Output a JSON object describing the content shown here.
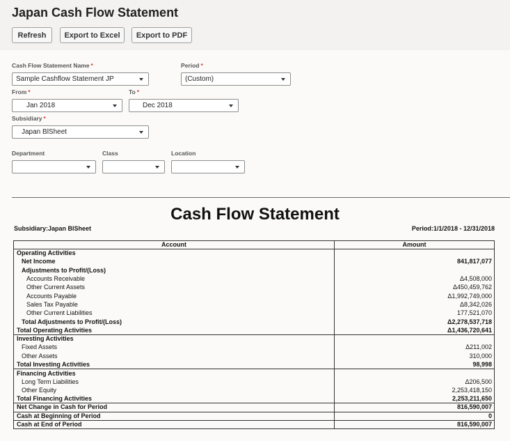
{
  "header": {
    "title": "Japan Cash Flow Statement",
    "buttons": {
      "refresh": "Refresh",
      "export_excel": "Export to Excel",
      "export_pdf": "Export to PDF"
    }
  },
  "filters": {
    "statement_name": {
      "label": "Cash Flow Statement Name",
      "value": "Sample Cashflow Statement JP"
    },
    "period": {
      "label": "Period",
      "value": "(Custom)"
    },
    "from": {
      "label": "From",
      "value": "Jan 2018"
    },
    "to": {
      "label": "To",
      "value": "Dec 2018"
    },
    "subsidiary": {
      "label": "Subsidiary",
      "value": "Japan BlSheet"
    },
    "department": {
      "label": "Department",
      "value": ""
    },
    "class": {
      "label": "Class",
      "value": ""
    },
    "location": {
      "label": "Location",
      "value": ""
    },
    "required_mark": "*"
  },
  "report": {
    "title": "Cash Flow Statement",
    "subsidiary_line": "Subsidiary:Japan BlSheet",
    "period_line": "Period:1/1/2018 - 12/31/2018",
    "columns": {
      "account": "Account",
      "amount": "Amount"
    },
    "rows": [
      {
        "account": "Operating Activities",
        "amount": "",
        "level": 0,
        "bold": true,
        "sep": false
      },
      {
        "account": "Net Income",
        "amount": "841,817,077",
        "level": 1,
        "bold": true,
        "sep": false
      },
      {
        "account": "Adjustments to Profit/(Loss)",
        "amount": "",
        "level": 1,
        "bold": true,
        "sep": false
      },
      {
        "account": "Accounts Receivable",
        "amount": "Δ4,508,000",
        "level": 2,
        "bold": false,
        "sep": false
      },
      {
        "account": "Other Current Assets",
        "amount": "Δ450,459,762",
        "level": 2,
        "bold": false,
        "sep": false
      },
      {
        "account": "Accounts Payable",
        "amount": "Δ1,992,749,000",
        "level": 2,
        "bold": false,
        "sep": false
      },
      {
        "account": "Sales Tax Payable",
        "amount": "Δ8,342,026",
        "level": 2,
        "bold": false,
        "sep": false
      },
      {
        "account": "Other Current Liabilities",
        "amount": "177,521,070",
        "level": 2,
        "bold": false,
        "sep": false
      },
      {
        "account": "Total Adjustments to Profit/(Loss)",
        "amount": "Δ2,278,537,718",
        "level": 1,
        "bold": true,
        "sep": false
      },
      {
        "account": "Total Operating Activities",
        "amount": "Δ1,436,720,641",
        "level": 0,
        "bold": true,
        "sep": false
      },
      {
        "account": "Investing Activities",
        "amount": "",
        "level": 0,
        "bold": true,
        "sep": true
      },
      {
        "account": "Fixed Assets",
        "amount": "Δ211,002",
        "level": 1,
        "bold": false,
        "sep": false
      },
      {
        "account": "Other Assets",
        "amount": "310,000",
        "level": 1,
        "bold": false,
        "sep": false
      },
      {
        "account": "Total Investing Activities",
        "amount": "98,998",
        "level": 0,
        "bold": true,
        "sep": false
      },
      {
        "account": "Financing Activities",
        "amount": "",
        "level": 0,
        "bold": true,
        "sep": true
      },
      {
        "account": "Long Term Liabilities",
        "amount": "Δ206,500",
        "level": 1,
        "bold": false,
        "sep": false
      },
      {
        "account": "Other Equity",
        "amount": "2,253,418,150",
        "level": 1,
        "bold": false,
        "sep": false
      },
      {
        "account": "Total Financing Activities",
        "amount": "2,253,211,650",
        "level": 0,
        "bold": true,
        "sep": false
      },
      {
        "account": "Net Change in Cash for Period",
        "amount": "816,590,007",
        "level": 0,
        "bold": true,
        "sep": true
      },
      {
        "account": "Cash at Beginning of Period",
        "amount": "0",
        "level": 0,
        "bold": true,
        "sep": true
      },
      {
        "account": "Cash at End of Period",
        "amount": "816,590,007",
        "level": 0,
        "bold": true,
        "sep": true
      }
    ]
  }
}
